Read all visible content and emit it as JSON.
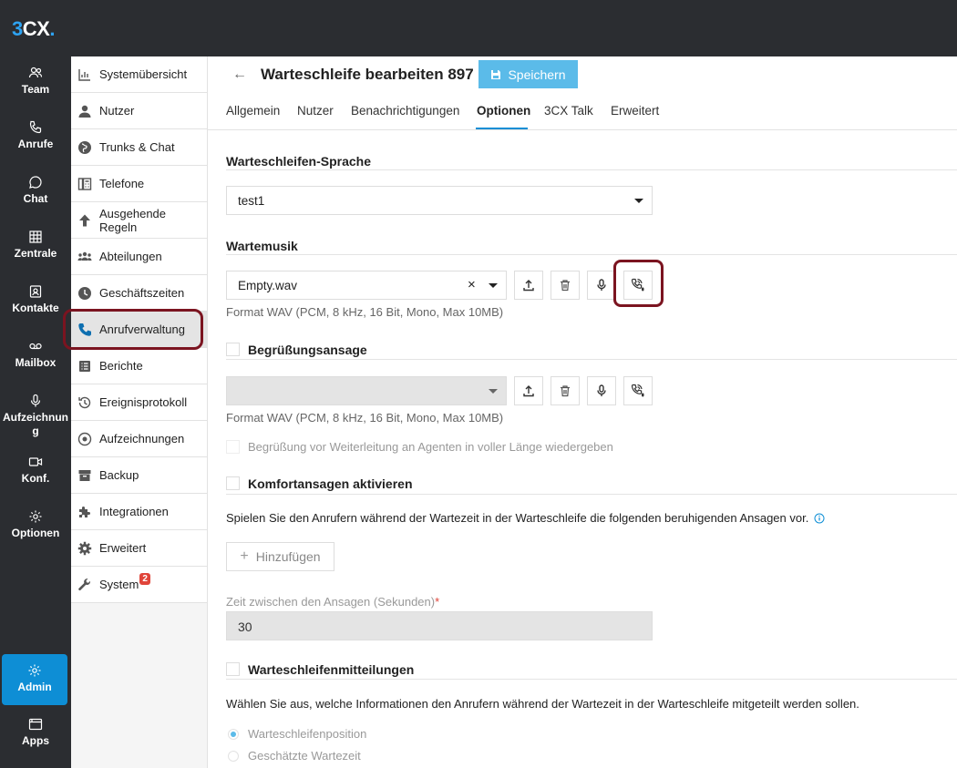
{
  "app": {
    "logo_3": "3",
    "logo_cx": "CX",
    "logo_dot": "."
  },
  "rail": [
    {
      "label": "Team",
      "icon": "team-icon"
    },
    {
      "label": "Anrufe",
      "icon": "phone-icon"
    },
    {
      "label": "Chat",
      "icon": "chat-icon"
    },
    {
      "label": "Zentrale",
      "icon": "grid-icon"
    },
    {
      "label": "Kontakte",
      "icon": "contacts-icon"
    },
    {
      "label": "Mailbox",
      "icon": "voicemail-icon"
    },
    {
      "label": "Aufzeichnung",
      "icon": "mic-icon"
    },
    {
      "label": "Konf.",
      "icon": "video-icon"
    },
    {
      "label": "Optionen",
      "icon": "gear-icon"
    },
    {
      "label": "Admin",
      "icon": "gear-icon"
    },
    {
      "label": "Apps",
      "icon": "apps-icon"
    }
  ],
  "rail_aufzeichnung_line1": "Aufzeichnun",
  "rail_aufzeichnung_line2": "g",
  "nav": {
    "items": [
      {
        "label": "Systemübersicht",
        "icon": "dashboard-icon"
      },
      {
        "label": "Nutzer",
        "icon": "user-icon"
      },
      {
        "label": "Trunks & Chat",
        "icon": "globe-icon"
      },
      {
        "label": "Telefone",
        "icon": "desk-phone-icon"
      },
      {
        "label": "Ausgehende Regeln",
        "icon": "arrow-up-icon"
      },
      {
        "label": "Abteilungen",
        "icon": "departments-icon"
      },
      {
        "label": "Geschäftszeiten",
        "icon": "clock-icon"
      },
      {
        "label": "Anrufverwaltung",
        "icon": "phone-icon"
      },
      {
        "label": "Berichte",
        "icon": "report-icon"
      },
      {
        "label": "Ereignisprotokoll",
        "icon": "history-icon"
      },
      {
        "label": "Aufzeichnungen",
        "icon": "record-icon"
      },
      {
        "label": "Backup",
        "icon": "archive-icon"
      },
      {
        "label": "Integrationen",
        "icon": "puzzle-icon"
      },
      {
        "label": "Erweitert",
        "icon": "gear-icon"
      },
      {
        "label": "System",
        "icon": "wrench-icon",
        "badge": "2"
      }
    ],
    "ausgehende_line1": "Ausgehende",
    "ausgehende_line2": "Regeln"
  },
  "header": {
    "title": "Warteschleife bearbeiten 897",
    "save_label": "Speichern"
  },
  "tabs": [
    "Allgemein",
    "Nutzer",
    "Benachrichtigungen",
    "Optionen",
    "3CX Talk",
    "Erweitert"
  ],
  "active_tab": "Optionen",
  "language": {
    "title": "Warteschleifen-Sprache",
    "value": "test1"
  },
  "music": {
    "title": "Wartemusik",
    "value": "Empty.wav",
    "format_hint": "Format WAV (PCM, 8 kHz, 16 Bit, Mono, Max 10MB)"
  },
  "greeting": {
    "title": "Begrüßungsansage",
    "value": "",
    "format_hint": "Format WAV (PCM, 8 kHz, 16 Bit, Mono, Max 10MB)",
    "full_length_label": "Begrüßung vor Weiterleitung an Agenten in voller Länge wiedergeben"
  },
  "comfort": {
    "title": "Komfortansagen aktivieren",
    "description": "Spielen Sie den Anrufern während der Wartezeit in der Warteschleife die folgenden beruhigenden Ansagen vor.",
    "add_label": "Hinzufügen",
    "interval_label": "Zeit zwischen den Ansagen (Sekunden)",
    "required_mark": "*",
    "interval_value": "30"
  },
  "queue_messages": {
    "title": "Warteschleifenmitteilungen",
    "description": "Wählen Sie aus, welche Informationen den Anrufern während der Wartezeit in der Warteschleife mitgeteilt werden sollen.",
    "options": [
      "Warteschleifenposition",
      "Geschätzte Wartezeit"
    ],
    "selected": "Warteschleifenposition"
  },
  "colors": {
    "accent": "#0e8ed5",
    "save": "#5bbbe9",
    "highlight": "#7b1420",
    "badge": "#e0453a"
  }
}
